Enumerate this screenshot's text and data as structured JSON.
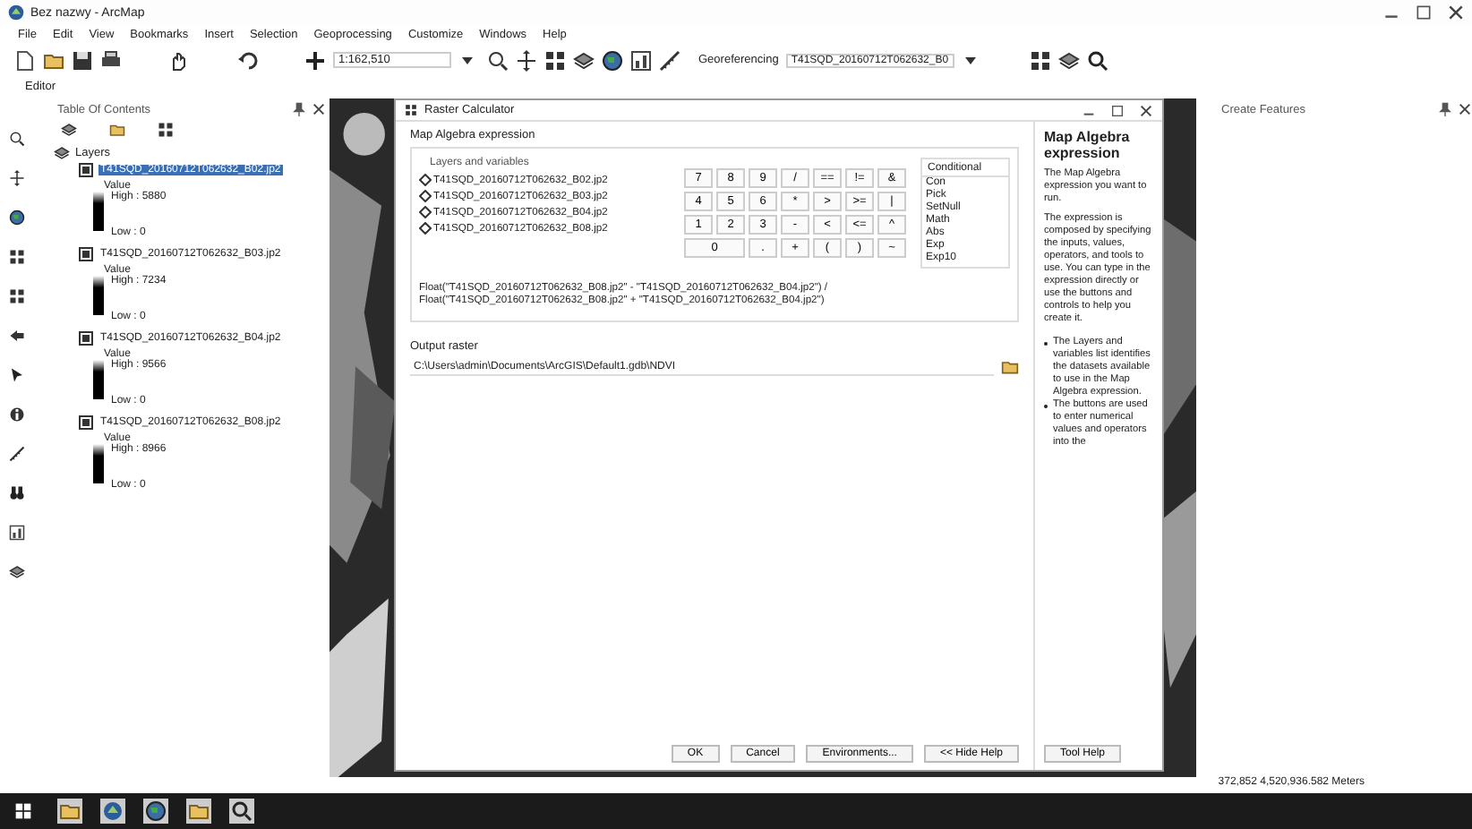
{
  "window": {
    "title": "Bez nazwy - ArcMap"
  },
  "menu": [
    "File",
    "Edit",
    "View",
    "Bookmarks",
    "Insert",
    "Selection",
    "Geoprocessing",
    "Customize",
    "Windows",
    "Help"
  ],
  "toolbar": {
    "scale": "1:162,510",
    "georeferencing_label": "Georeferencing",
    "georeferencing_layer": "T41SQD_20160712T062632_B0"
  },
  "editor": {
    "label": "Editor"
  },
  "toc": {
    "title": "Table Of Contents",
    "root": "Layers",
    "layers": [
      {
        "name": "T41SQD_20160712T062632_B02.jp2",
        "selected": true,
        "checked": true,
        "legend_title": "Value",
        "high": "High : 5880",
        "low": "Low : 0"
      },
      {
        "name": "T41SQD_20160712T062632_B03.jp2",
        "selected": false,
        "checked": true,
        "legend_title": "Value",
        "high": "High : 7234",
        "low": "Low : 0"
      },
      {
        "name": "T41SQD_20160712T062632_B04.jp2",
        "selected": false,
        "checked": true,
        "legend_title": "Value",
        "high": "High : 9566",
        "low": "Low : 0"
      },
      {
        "name": "T41SQD_20160712T062632_B08.jp2",
        "selected": false,
        "checked": true,
        "legend_title": "Value",
        "high": "High : 8966",
        "low": "Low : 0"
      }
    ]
  },
  "dialog": {
    "title": "Raster Calculator",
    "section": "Map Algebra expression",
    "layers_label": "Layers and variables",
    "variables": [
      "T41SQD_20160712T062632_B02.jp2",
      "T41SQD_20160712T062632_B03.jp2",
      "T41SQD_20160712T062632_B04.jp2",
      "T41SQD_20160712T062632_B08.jp2"
    ],
    "keypad": [
      [
        "7",
        "8",
        "9",
        "/",
        "==",
        "!=",
        "&"
      ],
      [
        "4",
        "5",
        "6",
        "*",
        ">",
        ">=",
        "|"
      ],
      [
        "1",
        "2",
        "3",
        "-",
        "<",
        "<=",
        "^"
      ],
      [
        "0",
        ".",
        "+",
        "(",
        ")",
        "~"
      ]
    ],
    "functions_header": "Conditional",
    "functions": [
      "Con",
      "Pick",
      "SetNull",
      "Math",
      "Abs",
      "Exp",
      "Exp10"
    ],
    "expression": "Float(\"T41SQD_20160712T062632_B08.jp2\" - \"T41SQD_20160712T062632_B04.jp2\") / Float(\"T41SQD_20160712T062632_B08.jp2\" + \"T41SQD_20160712T062632_B04.jp2\")",
    "output_label": "Output raster",
    "output_value": "C:\\Users\\admin\\Documents\\ArcGIS\\Default1.gdb\\NDVI",
    "buttons": [
      "OK",
      "Cancel",
      "Environments...",
      "<< Hide Help"
    ],
    "help": {
      "title": "Map Algebra expression",
      "paragraphs": [
        "The Map Algebra expression you want to run.",
        "The expression is composed by specifying the inputs, values, operators, and tools to use. You can type in the expression directly or use the buttons and controls to help you create it."
      ],
      "bullets": [
        "The Layers and variables list identifies the datasets available to use in the Map Algebra expression.",
        "The buttons are used to enter numerical values and operators into the"
      ],
      "button": "Tool Help"
    }
  },
  "right_panel": {
    "title": "Create Features"
  },
  "status_bar": {
    "coordinates": "372,852  4,520,936.582 Meters"
  }
}
